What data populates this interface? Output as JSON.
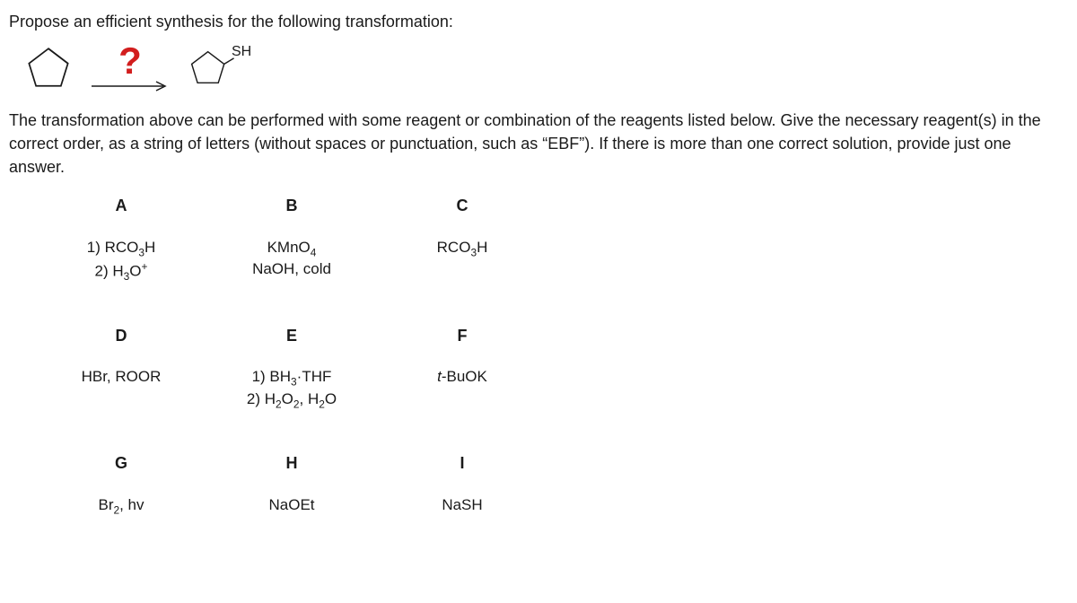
{
  "question": "Propose an efficient synthesis for the following transformation:",
  "reaction": {
    "qmark": "?",
    "sh": "SH"
  },
  "instructions": "The transformation above can be performed with some reagent or combination of the reagents listed below. Give the necessary reagent(s) in the correct order, as a string of letters (without spaces or punctuation, such as “EBF”). If there is more than one correct solution, provide just one answer.",
  "reagents": {
    "A": {
      "letter": "A",
      "line1": "1) RCO",
      "sub1": "3",
      "line1b": "H",
      "line2": "2) H",
      "sub2": "3",
      "line2b": "O",
      "sup2": "+"
    },
    "B": {
      "letter": "B",
      "line1": "KMnO",
      "sub1": "4",
      "line2": "NaOH, cold"
    },
    "C": {
      "letter": "C",
      "line1": "RCO",
      "sub1": "3",
      "line1b": "H"
    },
    "D": {
      "letter": "D",
      "line1": "HBr, ROOR"
    },
    "E": {
      "letter": "E",
      "line1": "1) BH",
      "sub1": "3",
      "line1b": "·THF",
      "line2": "2) H",
      "sub2": "2",
      "line2b": "O",
      "sub2b": "2",
      "line2c": ", H",
      "sub2c": "2",
      "line2d": "O"
    },
    "F": {
      "letter": "F",
      "italic": "t",
      "line1": "-BuOK"
    },
    "G": {
      "letter": "G",
      "line1": "Br",
      "sub1": "2",
      "line1b": ", hv"
    },
    "H": {
      "letter": "H",
      "line1": "NaOEt"
    },
    "I": {
      "letter": "I",
      "line1": "NaSH"
    }
  }
}
